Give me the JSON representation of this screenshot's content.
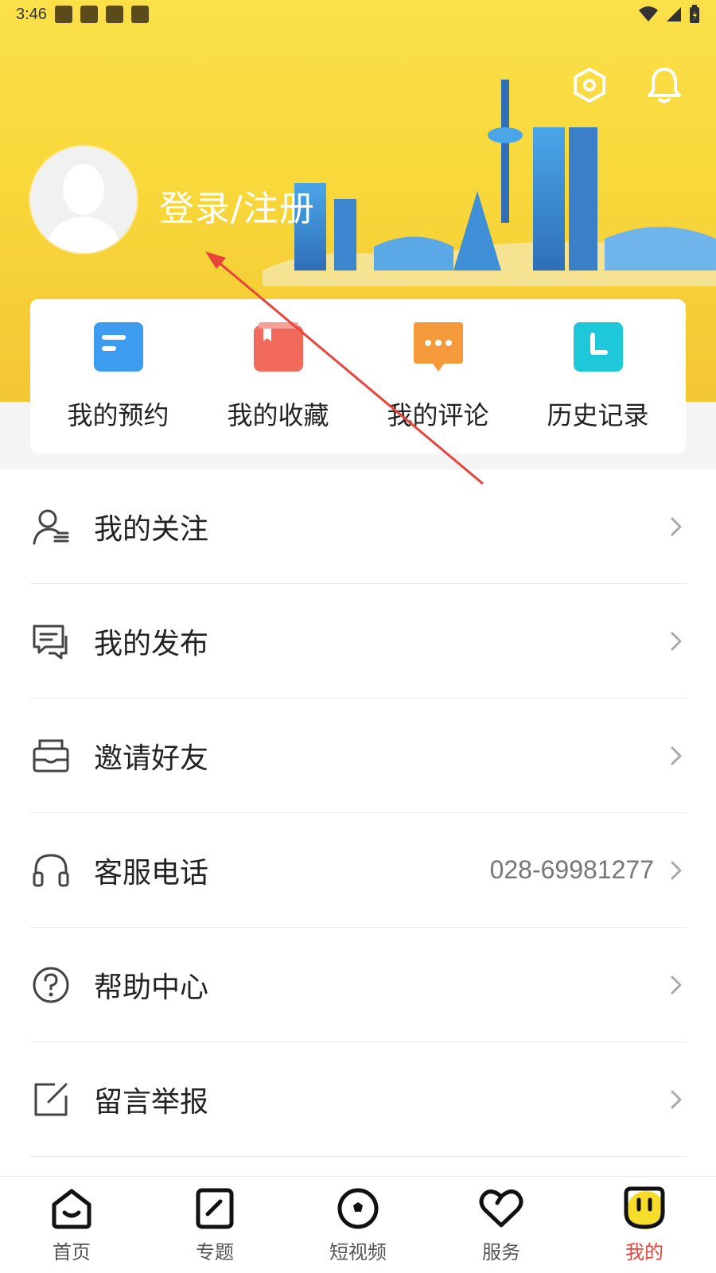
{
  "status_bar": {
    "time": "3:46"
  },
  "header": {
    "login_label": "登录/注册",
    "accent": "#f8d83a"
  },
  "quick_actions": [
    {
      "label": "我的预约",
      "icon": "reservation-icon",
      "color": "#3d9bf0"
    },
    {
      "label": "我的收藏",
      "icon": "favorites-icon",
      "color": "#f26a5c"
    },
    {
      "label": "我的评论",
      "icon": "comments-icon",
      "color": "#f59a3a"
    },
    {
      "label": "历史记录",
      "icon": "history-icon",
      "color": "#1fc8d8"
    }
  ],
  "menu": [
    {
      "label": "我的关注",
      "icon": "follow-user-icon",
      "value": ""
    },
    {
      "label": "我的发布",
      "icon": "publish-chat-icon",
      "value": ""
    },
    {
      "label": "邀请好友",
      "icon": "invite-mail-icon",
      "value": ""
    },
    {
      "label": "客服电话",
      "icon": "headset-icon",
      "value": "028-69981277"
    },
    {
      "label": "帮助中心",
      "icon": "help-question-icon",
      "value": ""
    },
    {
      "label": "留言举报",
      "icon": "edit-note-icon",
      "value": ""
    }
  ],
  "bottom_nav": [
    {
      "label": "首页",
      "icon": "home-icon",
      "active": false
    },
    {
      "label": "专题",
      "icon": "topic-icon",
      "active": false
    },
    {
      "label": "短视频",
      "icon": "short-video-icon",
      "active": false
    },
    {
      "label": "服务",
      "icon": "heart-service-icon",
      "active": false
    },
    {
      "label": "我的",
      "icon": "me-smile-icon",
      "active": true
    }
  ],
  "colors": {
    "active": "#e8443a",
    "annotation_arrow": "#e8443a"
  }
}
